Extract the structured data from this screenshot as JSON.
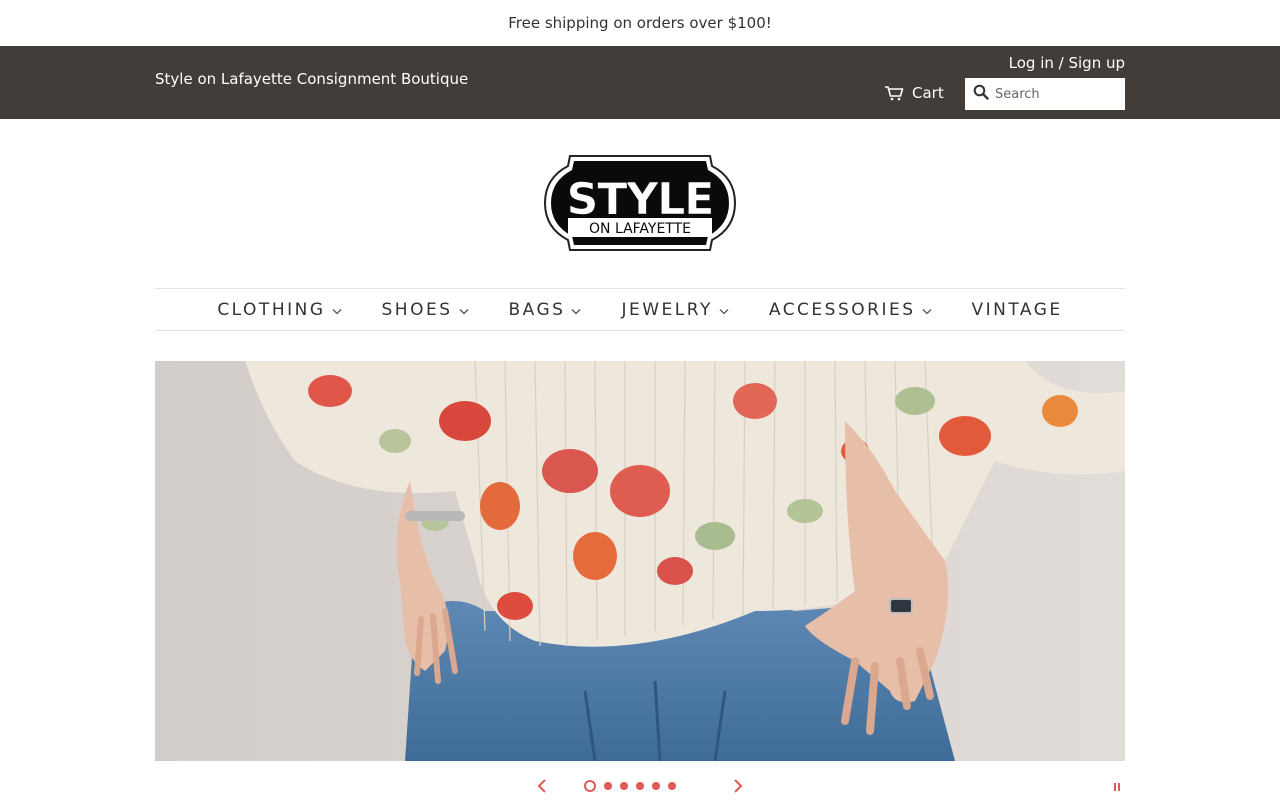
{
  "announcement": {
    "text": "Free shipping on orders over $100!"
  },
  "header": {
    "shop_name": "Style on Lafayette Consignment Boutique",
    "account_link": "Log in / Sign up",
    "cart_label": "Cart",
    "cart_icon": "cart-icon",
    "search_icon": "search-icon",
    "search_placeholder": "Search",
    "background_color": "#423d39"
  },
  "logo": {
    "line1": "STYLE",
    "line2": "ON LAFAYETTE"
  },
  "nav": {
    "items": [
      {
        "label": "CLOTHING",
        "has_dropdown": true
      },
      {
        "label": "SHOES",
        "has_dropdown": true
      },
      {
        "label": "BAGS",
        "has_dropdown": true
      },
      {
        "label": "JEWELRY",
        "has_dropdown": true
      },
      {
        "label": "ACCESSORIES",
        "has_dropdown": true
      },
      {
        "label": "VINTAGE",
        "has_dropdown": false
      }
    ]
  },
  "slideshow": {
    "slide_count": 6,
    "active_slide": 1,
    "prev_icon": "chevron-left-icon",
    "next_icon": "chevron-right-icon",
    "pause_icon": "pause-icon",
    "accent_color": "#e05a55"
  }
}
